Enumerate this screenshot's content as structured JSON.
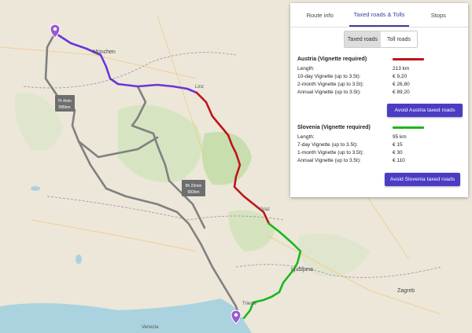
{
  "tabs": [
    {
      "label": "Route info"
    },
    {
      "label": "Taxed roads & Tolls"
    },
    {
      "label": "Stops"
    }
  ],
  "subtabs": [
    {
      "label": "Taxed roads"
    },
    {
      "label": "Toll roads"
    }
  ],
  "austria": {
    "title": "Austria (Vignette required)",
    "line_color": "#c0151b",
    "rows": [
      {
        "label": "Length:",
        "value": "213 km"
      },
      {
        "label": "10-day Vignette (up to 3.5t):",
        "value": "€ 9,20"
      },
      {
        "label": "2-month Vignette (up to 3.5t):",
        "value": "€ 26,80"
      },
      {
        "label": "Annual Vignette (up to 3.5t):",
        "value": "€ 89,20"
      }
    ],
    "button": "Avoid Austria taxed roads"
  },
  "slovenia": {
    "title": "Slovenia (Vignette required)",
    "line_color": "#19b81e",
    "rows": [
      {
        "label": "Length:",
        "value": "95 km"
      },
      {
        "label": "7-day Vignette (up to 3.5t):",
        "value": "€ 15"
      },
      {
        "label": "1-month Vignette (up to 3.5t):",
        "value": "€ 30"
      },
      {
        "label": "Annual Vignette (up to 3.5t):",
        "value": "€ 110"
      }
    ],
    "button": "Avoid Slovenia taxed roads"
  },
  "map": {
    "route_labels": [
      {
        "time": "7h 4min",
        "dist": "585km"
      },
      {
        "time": "8h 23min",
        "dist": "683km"
      }
    ],
    "places": [
      {
        "name": "München"
      },
      {
        "name": "Linz"
      },
      {
        "name": "Graz"
      },
      {
        "name": "Ljubljana"
      },
      {
        "name": "Zagreb"
      },
      {
        "name": "Venezia"
      },
      {
        "name": "Trieste"
      }
    ],
    "colors": {
      "purple_route": "#6a35d6",
      "red_route": "#c0151b",
      "green_route": "#19b81e",
      "grey_route": "#808080",
      "sea": "#aad3df",
      "pin": "#9b59d0",
      "button": "#4b3cc4"
    }
  }
}
